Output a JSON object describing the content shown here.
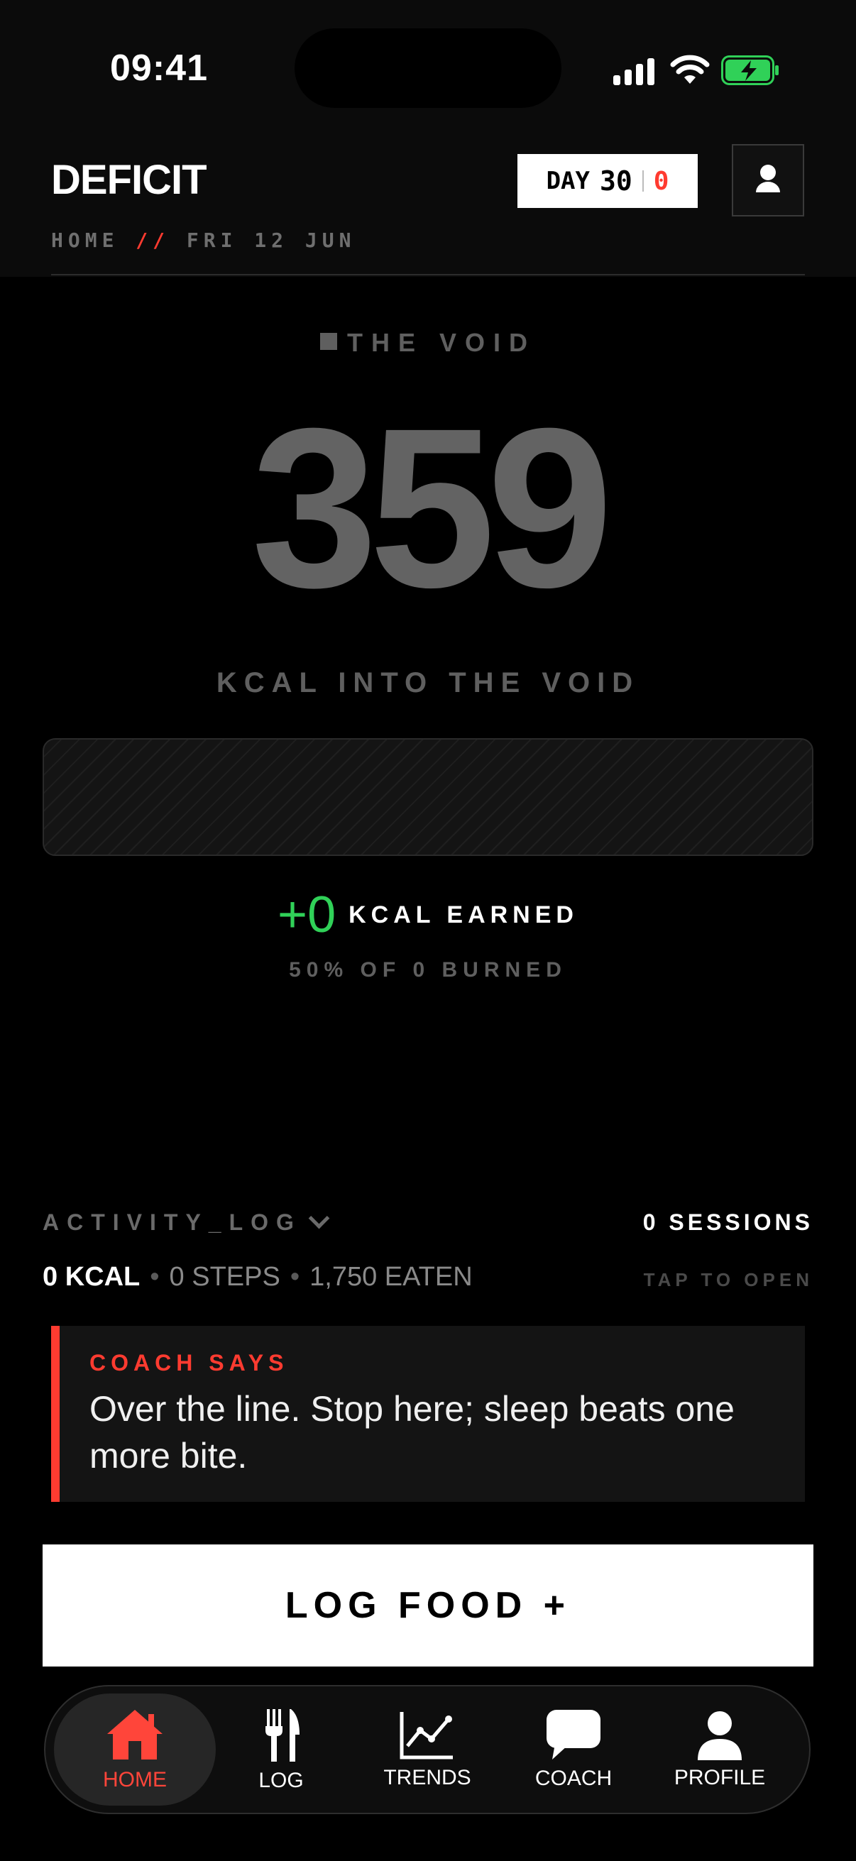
{
  "status_bar": {
    "time": "09:41"
  },
  "header": {
    "title": "DEFICIT",
    "day_label": "DAY",
    "day_number": "30",
    "streak_value": "0",
    "breadcrumb_home": "HOME",
    "breadcrumb_sep": "//",
    "breadcrumb_date": "FRI 12 JUN"
  },
  "void": {
    "label": "THE VOID",
    "value": "359",
    "caption": "KCAL INTO THE VOID",
    "bar_progress": 0,
    "earned_value": "+0",
    "earned_label": "KCAL EARNED",
    "burned_note": "50% OF 0 BURNED"
  },
  "activity": {
    "title": "ACTIVITY_LOG",
    "sessions": "0 SESSIONS",
    "kcal": "0 KCAL",
    "steps": "0 STEPS",
    "eaten": "1,750 EATEN",
    "tap_hint": "TAP TO OPEN"
  },
  "coach_card": {
    "label": "COACH SAYS",
    "message": "Over the line. Stop here; sleep beats one more bite."
  },
  "actions": {
    "log_food": "LOG FOOD +"
  },
  "tabs": [
    {
      "label": "HOME",
      "icon": "home-icon",
      "active": true
    },
    {
      "label": "LOG",
      "icon": "fork-knife-icon",
      "active": false
    },
    {
      "label": "TRENDS",
      "icon": "chart-icon",
      "active": false
    },
    {
      "label": "COACH",
      "icon": "chat-bubble-icon",
      "active": false
    },
    {
      "label": "PROFILE",
      "icon": "person-icon",
      "active": false
    }
  ],
  "colors": {
    "accent_red": "#ff3b30",
    "earned_green": "#30d158",
    "muted_grey": "#636363"
  }
}
